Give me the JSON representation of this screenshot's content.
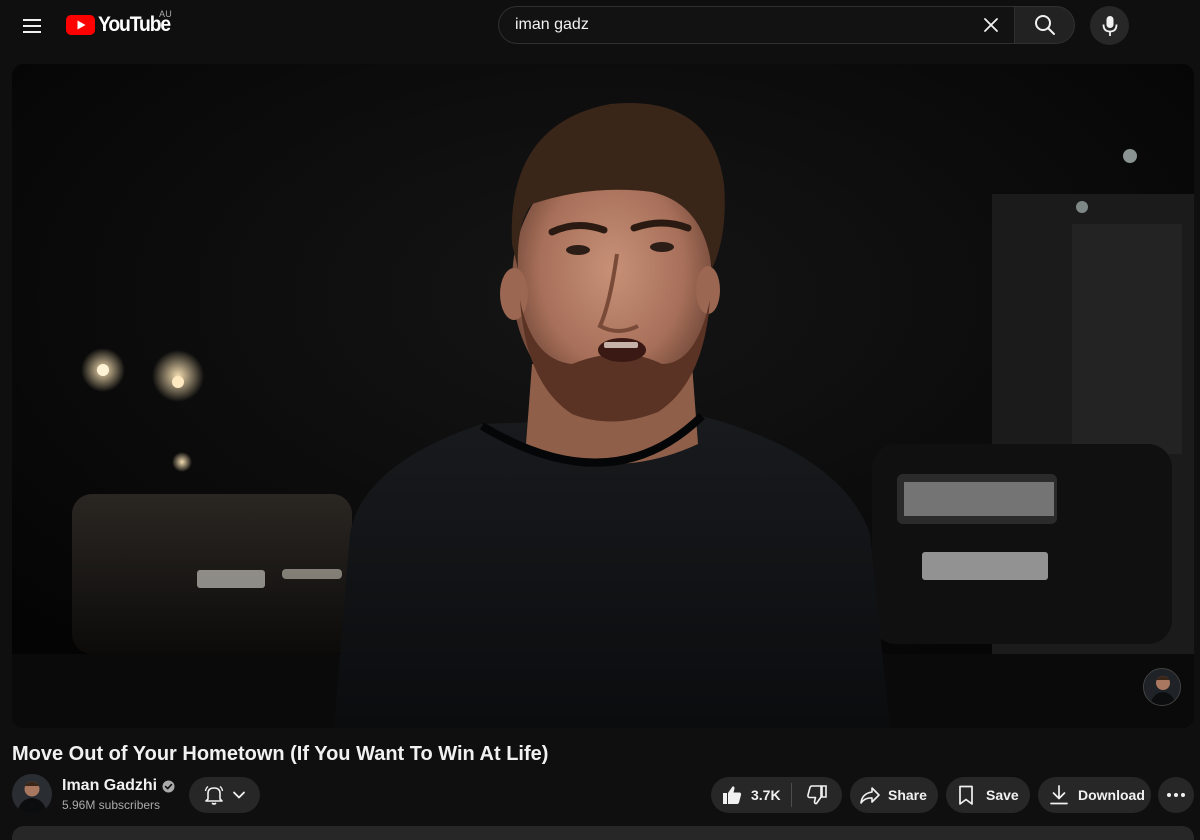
{
  "masthead": {
    "logo_text": "YouTube",
    "country_code": "AU",
    "search_value": "iman gadz",
    "search_placeholder": "Search",
    "icons": [
      "hamburger-menu-icon",
      "youtube-logo-icon",
      "close-icon",
      "search-icon",
      "microphone-icon"
    ]
  },
  "player": {
    "watermark_icon": "channel-watermark-icon"
  },
  "video": {
    "title": "Move Out of Your Hometown (If You Want To Win At Life)"
  },
  "channel": {
    "name": "Iman Gadzhi",
    "subscribers": "5.96M subscribers",
    "verified_icon": "verified-check-icon"
  },
  "actions": {
    "like_count": "3.7K",
    "share_label": "Share",
    "save_label": "Save",
    "download_label": "Download",
    "icons": [
      "bell-icon",
      "chevron-down-icon",
      "thumbs-up-icon",
      "thumbs-down-icon",
      "share-arrow-icon",
      "bookmark-icon",
      "download-icon",
      "more-horizontal-icon"
    ]
  },
  "colors": {
    "background": "#0f0f0f",
    "pill": "#272727",
    "brand_red": "#ff0000",
    "text_primary": "#f1f1f1",
    "text_secondary": "#aaaaaa"
  }
}
